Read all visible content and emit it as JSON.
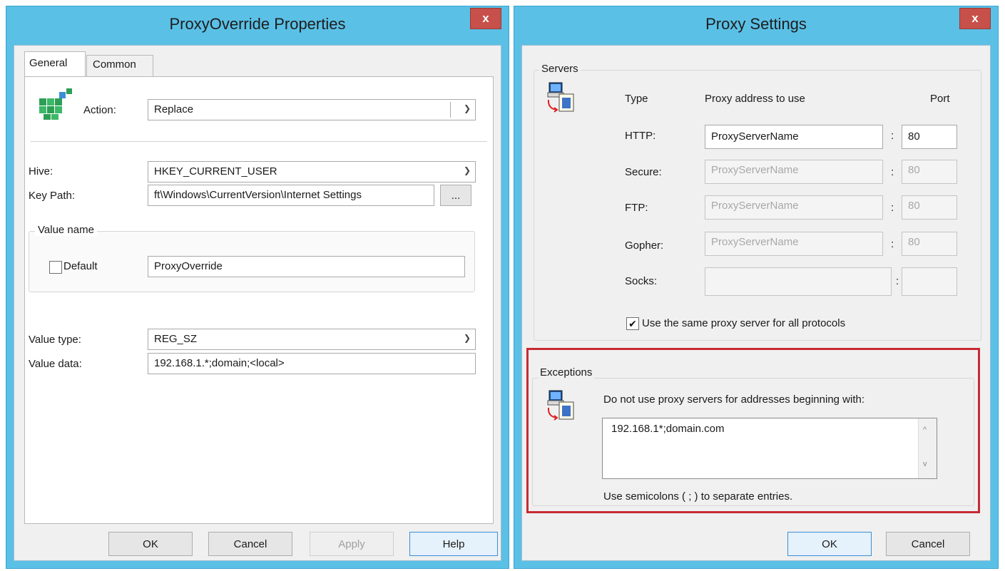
{
  "left_window": {
    "title": "ProxyOverride Properties",
    "close_label": "x",
    "tabs": [
      {
        "label": "General",
        "selected": true
      },
      {
        "label": "Common",
        "selected": false
      }
    ],
    "icon": "registry-icon",
    "action": {
      "label": "Action:",
      "value": "Replace"
    },
    "hive": {
      "label": "Hive:",
      "value": "HKEY_CURRENT_USER"
    },
    "key_path": {
      "label": "Key Path:",
      "value": "ft\\Windows\\CurrentVersion\\Internet Settings",
      "browse_label": "..."
    },
    "value_name": {
      "group_label": "Value name",
      "default_label": "Default",
      "default_checked": false,
      "value": "ProxyOverride"
    },
    "value_type": {
      "label": "Value type:",
      "value": "REG_SZ"
    },
    "value_data": {
      "label": "Value data:",
      "value": "192.168.1.*;domain;<local>"
    },
    "buttons": {
      "ok": "OK",
      "cancel": "Cancel",
      "apply": "Apply",
      "help": "Help"
    }
  },
  "right_window": {
    "title": "Proxy Settings",
    "close_label": "x",
    "servers": {
      "group_label": "Servers",
      "icon": "network-settings-icon",
      "headers": {
        "type": "Type",
        "address": "Proxy address to use",
        "port": "Port"
      },
      "rows": [
        {
          "type": "HTTP:",
          "address": "ProxyServerName",
          "port": "80",
          "enabled": true
        },
        {
          "type": "Secure:",
          "address": "ProxyServerName",
          "port": "80",
          "enabled": false
        },
        {
          "type": "FTP:",
          "address": "ProxyServerName",
          "port": "80",
          "enabled": false
        },
        {
          "type": "Gopher:",
          "address": "ProxyServerName",
          "port": "80",
          "enabled": false
        },
        {
          "type": "Socks:",
          "address": "",
          "port": "",
          "enabled": false
        }
      ],
      "colon": ":",
      "same_proxy_label": "Use the same proxy server for all protocols",
      "same_proxy_checked": true
    },
    "exceptions": {
      "group_label": "Exceptions",
      "icon": "network-settings-icon",
      "description": "Do not use proxy servers for addresses beginning with:",
      "value": "192.168.1*;domain.com",
      "hint": "Use semicolons ( ; ) to separate entries.",
      "highlight_color": "#c62a33"
    },
    "buttons": {
      "ok": "OK",
      "cancel": "Cancel"
    }
  },
  "colors": {
    "titlebar": "#5bc0e6",
    "close": "#c7504a",
    "dialog_bg": "#f0f0f0"
  }
}
